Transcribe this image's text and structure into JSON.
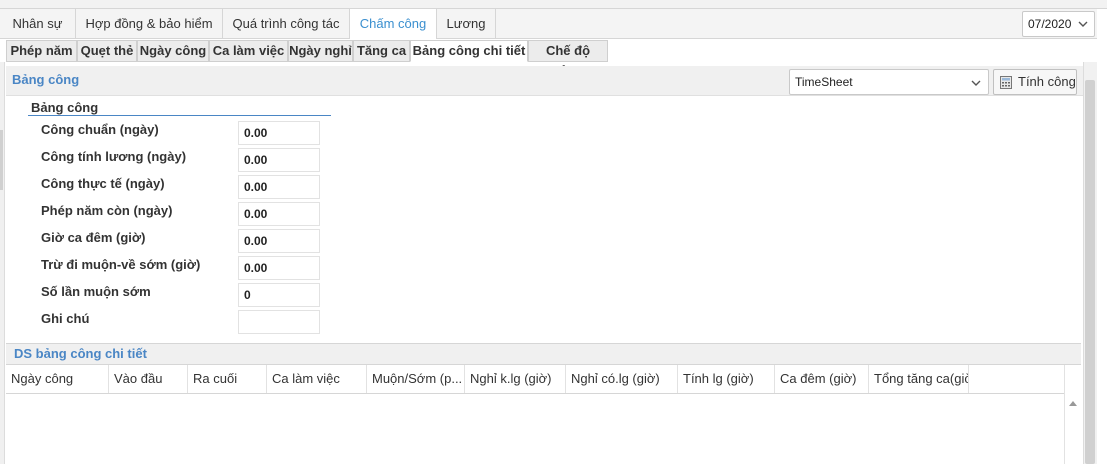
{
  "main_tabs": [
    {
      "label": "Nhân sự",
      "active": false
    },
    {
      "label": "Hợp đồng & bảo hiểm",
      "active": false
    },
    {
      "label": "Quá trình công tác",
      "active": false
    },
    {
      "label": "Chấm công",
      "active": true
    },
    {
      "label": "Lương",
      "active": false
    }
  ],
  "period": {
    "value": "07/2020"
  },
  "sub_tabs": [
    {
      "label": "Phép năm",
      "active": false
    },
    {
      "label": "Quẹt thẻ",
      "active": false
    },
    {
      "label": "Ngày công",
      "active": false
    },
    {
      "label": "Ca làm việc",
      "active": false
    },
    {
      "label": "Ngày nghỉ",
      "active": false
    },
    {
      "label": "Tăng ca",
      "active": false
    },
    {
      "label": "Bảng công chi tiết",
      "active": true
    },
    {
      "label": "Chế độ công",
      "active": false
    }
  ],
  "panel": {
    "title": "Bảng công",
    "timesheet_select": "TimeSheet",
    "calc_button": "Tính công",
    "calc_icon": "calculator-icon",
    "accent_color": "#4a86c5"
  },
  "fieldset": {
    "legend": "Bảng công",
    "fields": [
      {
        "label": "Công chuẩn (ngày)",
        "value": "0.00"
      },
      {
        "label": "Công tính lương (ngày)",
        "value": "0.00"
      },
      {
        "label": "Công thực tế (ngày)",
        "value": "0.00"
      },
      {
        "label": "Phép năm còn (ngày)",
        "value": "0.00"
      },
      {
        "label": "Giờ ca đêm (giờ)",
        "value": "0.00"
      },
      {
        "label": "Trừ đi muộn-về sớm (giờ)",
        "value": "0.00"
      },
      {
        "label": "Số lần muộn sớm",
        "value": "0"
      },
      {
        "label": "Ghi chú",
        "value": ""
      }
    ]
  },
  "detail_table": {
    "title": "DS bảng công chi tiết",
    "columns": [
      "Ngày công",
      "Vào đầu",
      "Ra cuối",
      "Ca làm việc",
      "Muộn/Sớm (p...",
      "Nghỉ k.lg (giờ)",
      "Nghỉ có.lg (giờ)",
      "Tính lg (giờ)",
      "Ca đêm (giờ)",
      "Tổng tăng ca(giờ)"
    ],
    "rows": []
  }
}
